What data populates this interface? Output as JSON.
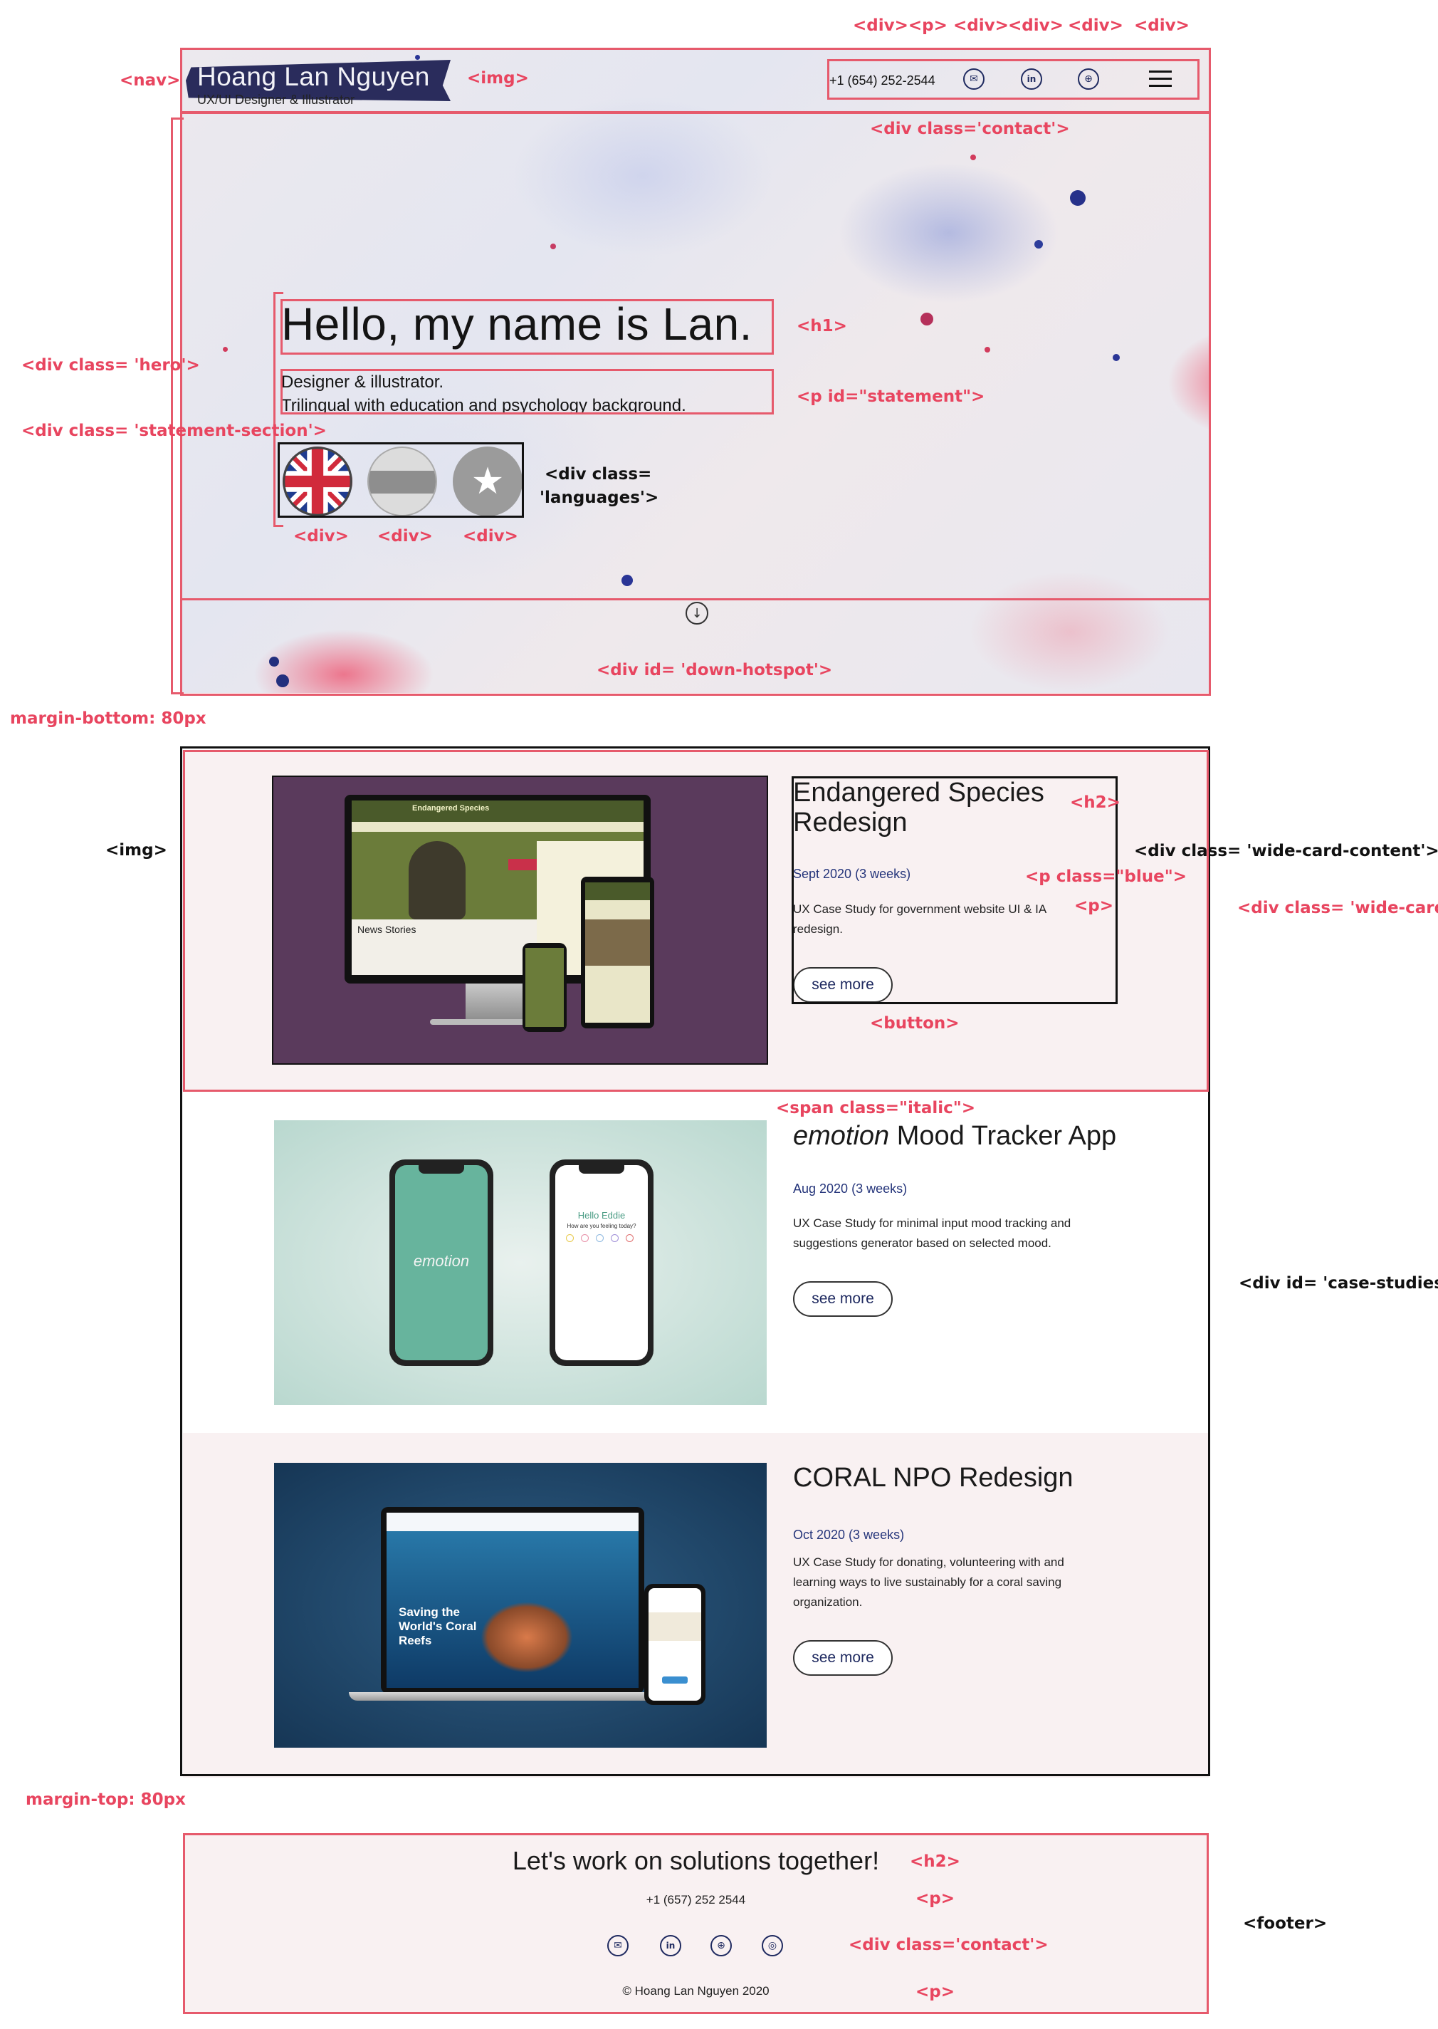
{
  "annotations": {
    "top_tags": [
      "<div><p>",
      "<div>",
      "<div>",
      "<div>",
      "<div>"
    ],
    "nav": "<nav>",
    "logo_img": "<img>",
    "contact": "<div class='contact'>",
    "hero": "<div class= 'hero'>",
    "statement_section": "<div class= 'statement-section'>",
    "h1": "<h1>",
    "statement_p": "<p id=\"statement\">",
    "languages_line1": "<div class=",
    "languages_line2": "'languages'>",
    "flag_divs": [
      "<div>",
      "<div>",
      "<div>"
    ],
    "down_hotspot": "<div id= 'down-hotspot'>",
    "margin_bottom": "margin-bottom: 80px",
    "card_img": "<img>",
    "h2": "<h2>",
    "wide_card_content": "<div class= 'wide-card-content'>",
    "p_blue": "<p class=\"blue\">",
    "p": "<p>",
    "wide_card": "<div class= 'wide-card'>",
    "button": "<button>",
    "span_italic": "<span class=\"italic\">",
    "case_studies": "<div id= 'case-studies'>",
    "margin_top": "margin-top: 80px",
    "footer_h2": "<h2>",
    "footer_p": "<p>",
    "footer_contact": "<div class='contact'>",
    "footer_p2": "<p>",
    "footer": "<footer>"
  },
  "nav": {
    "name": "Hoang Lan Nguyen",
    "subtitle": "UX/UI Designer & Illustrator",
    "phone": "+1 (654) 252-2544",
    "icons": [
      "mail-icon",
      "linkedin-icon",
      "dribbble-icon"
    ]
  },
  "hero": {
    "heading": "Hello, my name is Lan.",
    "statement_line1": "Designer & illustrator.",
    "statement_line2": "Trilingual with education and psychology background.",
    "languages": [
      "uk-flag-icon",
      "grey-flag-icon",
      "star-flag-icon"
    ],
    "down_icon": "arrow-down-circle-icon"
  },
  "case_studies": [
    {
      "title_line1": "Endangered Species",
      "title_line2": "Redesign",
      "date": "Sept 2020 (3 weeks)",
      "desc_line1": "UX Case Study for government website UI & IA",
      "desc_line2": "redesign.",
      "button": "see more",
      "mock": {
        "banner": "Endangered Species",
        "news": "News Stories"
      }
    },
    {
      "title_italic": "emotion",
      "title_rest": " Mood Tracker App",
      "date": "Aug 2020 (3 weeks)",
      "desc_line1": "UX Case Study for minimal input mood tracking and",
      "desc_line2": "suggestions generator based on selected mood.",
      "button": "see more",
      "mock": {
        "app_name": "emotion",
        "greeting": "Hello Eddie",
        "question": "How are you feeling today?"
      }
    },
    {
      "title": "CORAL NPO Redesign",
      "date": "Oct 2020 (3 weeks)",
      "desc_line1": "UX Case Study for donating, volunteering with and",
      "desc_line2": "learning ways to live sustainably for a coral saving",
      "desc_line3": "organization.",
      "button": "see more",
      "mock": {
        "hero_text_1": "Saving the",
        "hero_text_2": "World's Coral",
        "hero_text_3": "Reefs"
      }
    }
  ],
  "footer": {
    "title": "Let's work on solutions together!",
    "phone": "+1 (657) 252 2544",
    "icons": [
      "mail-icon",
      "linkedin-icon",
      "dribbble-icon",
      "instagram-icon"
    ],
    "copyright": "© Hoang Lan Nguyen 2020"
  },
  "colors": {
    "annotation_red": "#e8455f",
    "navy": "#1f2a60",
    "card_pink": "#f9f1f2"
  }
}
